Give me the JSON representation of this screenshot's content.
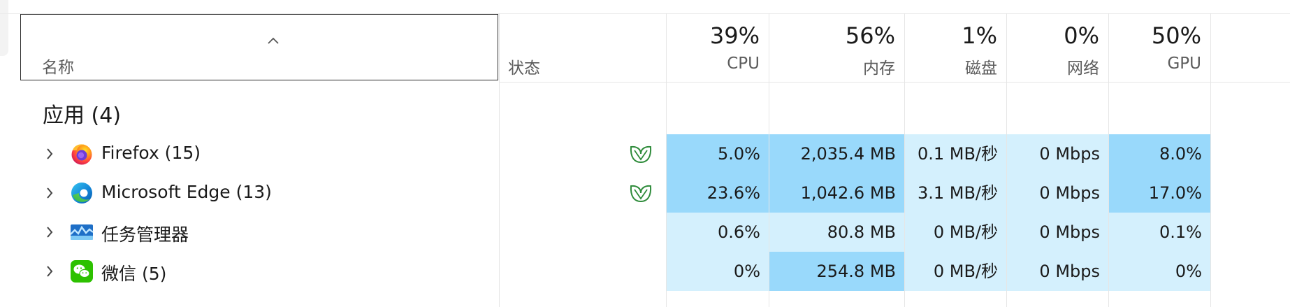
{
  "header": {
    "name_label": "名称",
    "status_label": "状态",
    "columns": [
      {
        "key": "cpu",
        "pct": "39%",
        "label": "CPU"
      },
      {
        "key": "memory",
        "pct": "56%",
        "label": "内存"
      },
      {
        "key": "disk",
        "pct": "1%",
        "label": "磁盘"
      },
      {
        "key": "network",
        "pct": "0%",
        "label": "网络"
      },
      {
        "key": "gpu",
        "pct": "50%",
        "label": "GPU"
      }
    ]
  },
  "group": {
    "title": "应用 (4)"
  },
  "rows": [
    {
      "name": "Firefox (15)",
      "icon": "firefox-icon",
      "efficiency": true,
      "cpu": "5.0%",
      "memory": "2,035.4 MB",
      "disk": "0.1 MB/秒",
      "network": "0 Mbps",
      "gpu": "8.0%",
      "heat": {
        "cpu": "strong",
        "memory": "strong",
        "disk": "light",
        "network": "light",
        "gpu": "strong"
      }
    },
    {
      "name": "Microsoft Edge (13)",
      "icon": "edge-icon",
      "efficiency": true,
      "cpu": "23.6%",
      "memory": "1,042.6 MB",
      "disk": "3.1 MB/秒",
      "network": "0 Mbps",
      "gpu": "17.0%",
      "heat": {
        "cpu": "strong",
        "memory": "strong",
        "disk": "light",
        "network": "light",
        "gpu": "strong"
      }
    },
    {
      "name": "任务管理器",
      "icon": "task-manager-icon",
      "efficiency": false,
      "cpu": "0.6%",
      "memory": "80.8 MB",
      "disk": "0 MB/秒",
      "network": "0 Mbps",
      "gpu": "0.1%",
      "heat": {
        "cpu": "light",
        "memory": "light",
        "disk": "light",
        "network": "light",
        "gpu": "light"
      }
    },
    {
      "name": "微信 (5)",
      "icon": "wechat-icon",
      "efficiency": false,
      "cpu": "0%",
      "memory": "254.8 MB",
      "disk": "0 MB/秒",
      "network": "0 Mbps",
      "gpu": "0%",
      "heat": {
        "cpu": "light",
        "memory": "strong",
        "disk": "light",
        "network": "light",
        "gpu": "light"
      }
    }
  ],
  "colors": {
    "heat_strong": "#99d9fb",
    "heat_light": "#d4f0fd",
    "leaf_green": "#2e8b3a"
  }
}
